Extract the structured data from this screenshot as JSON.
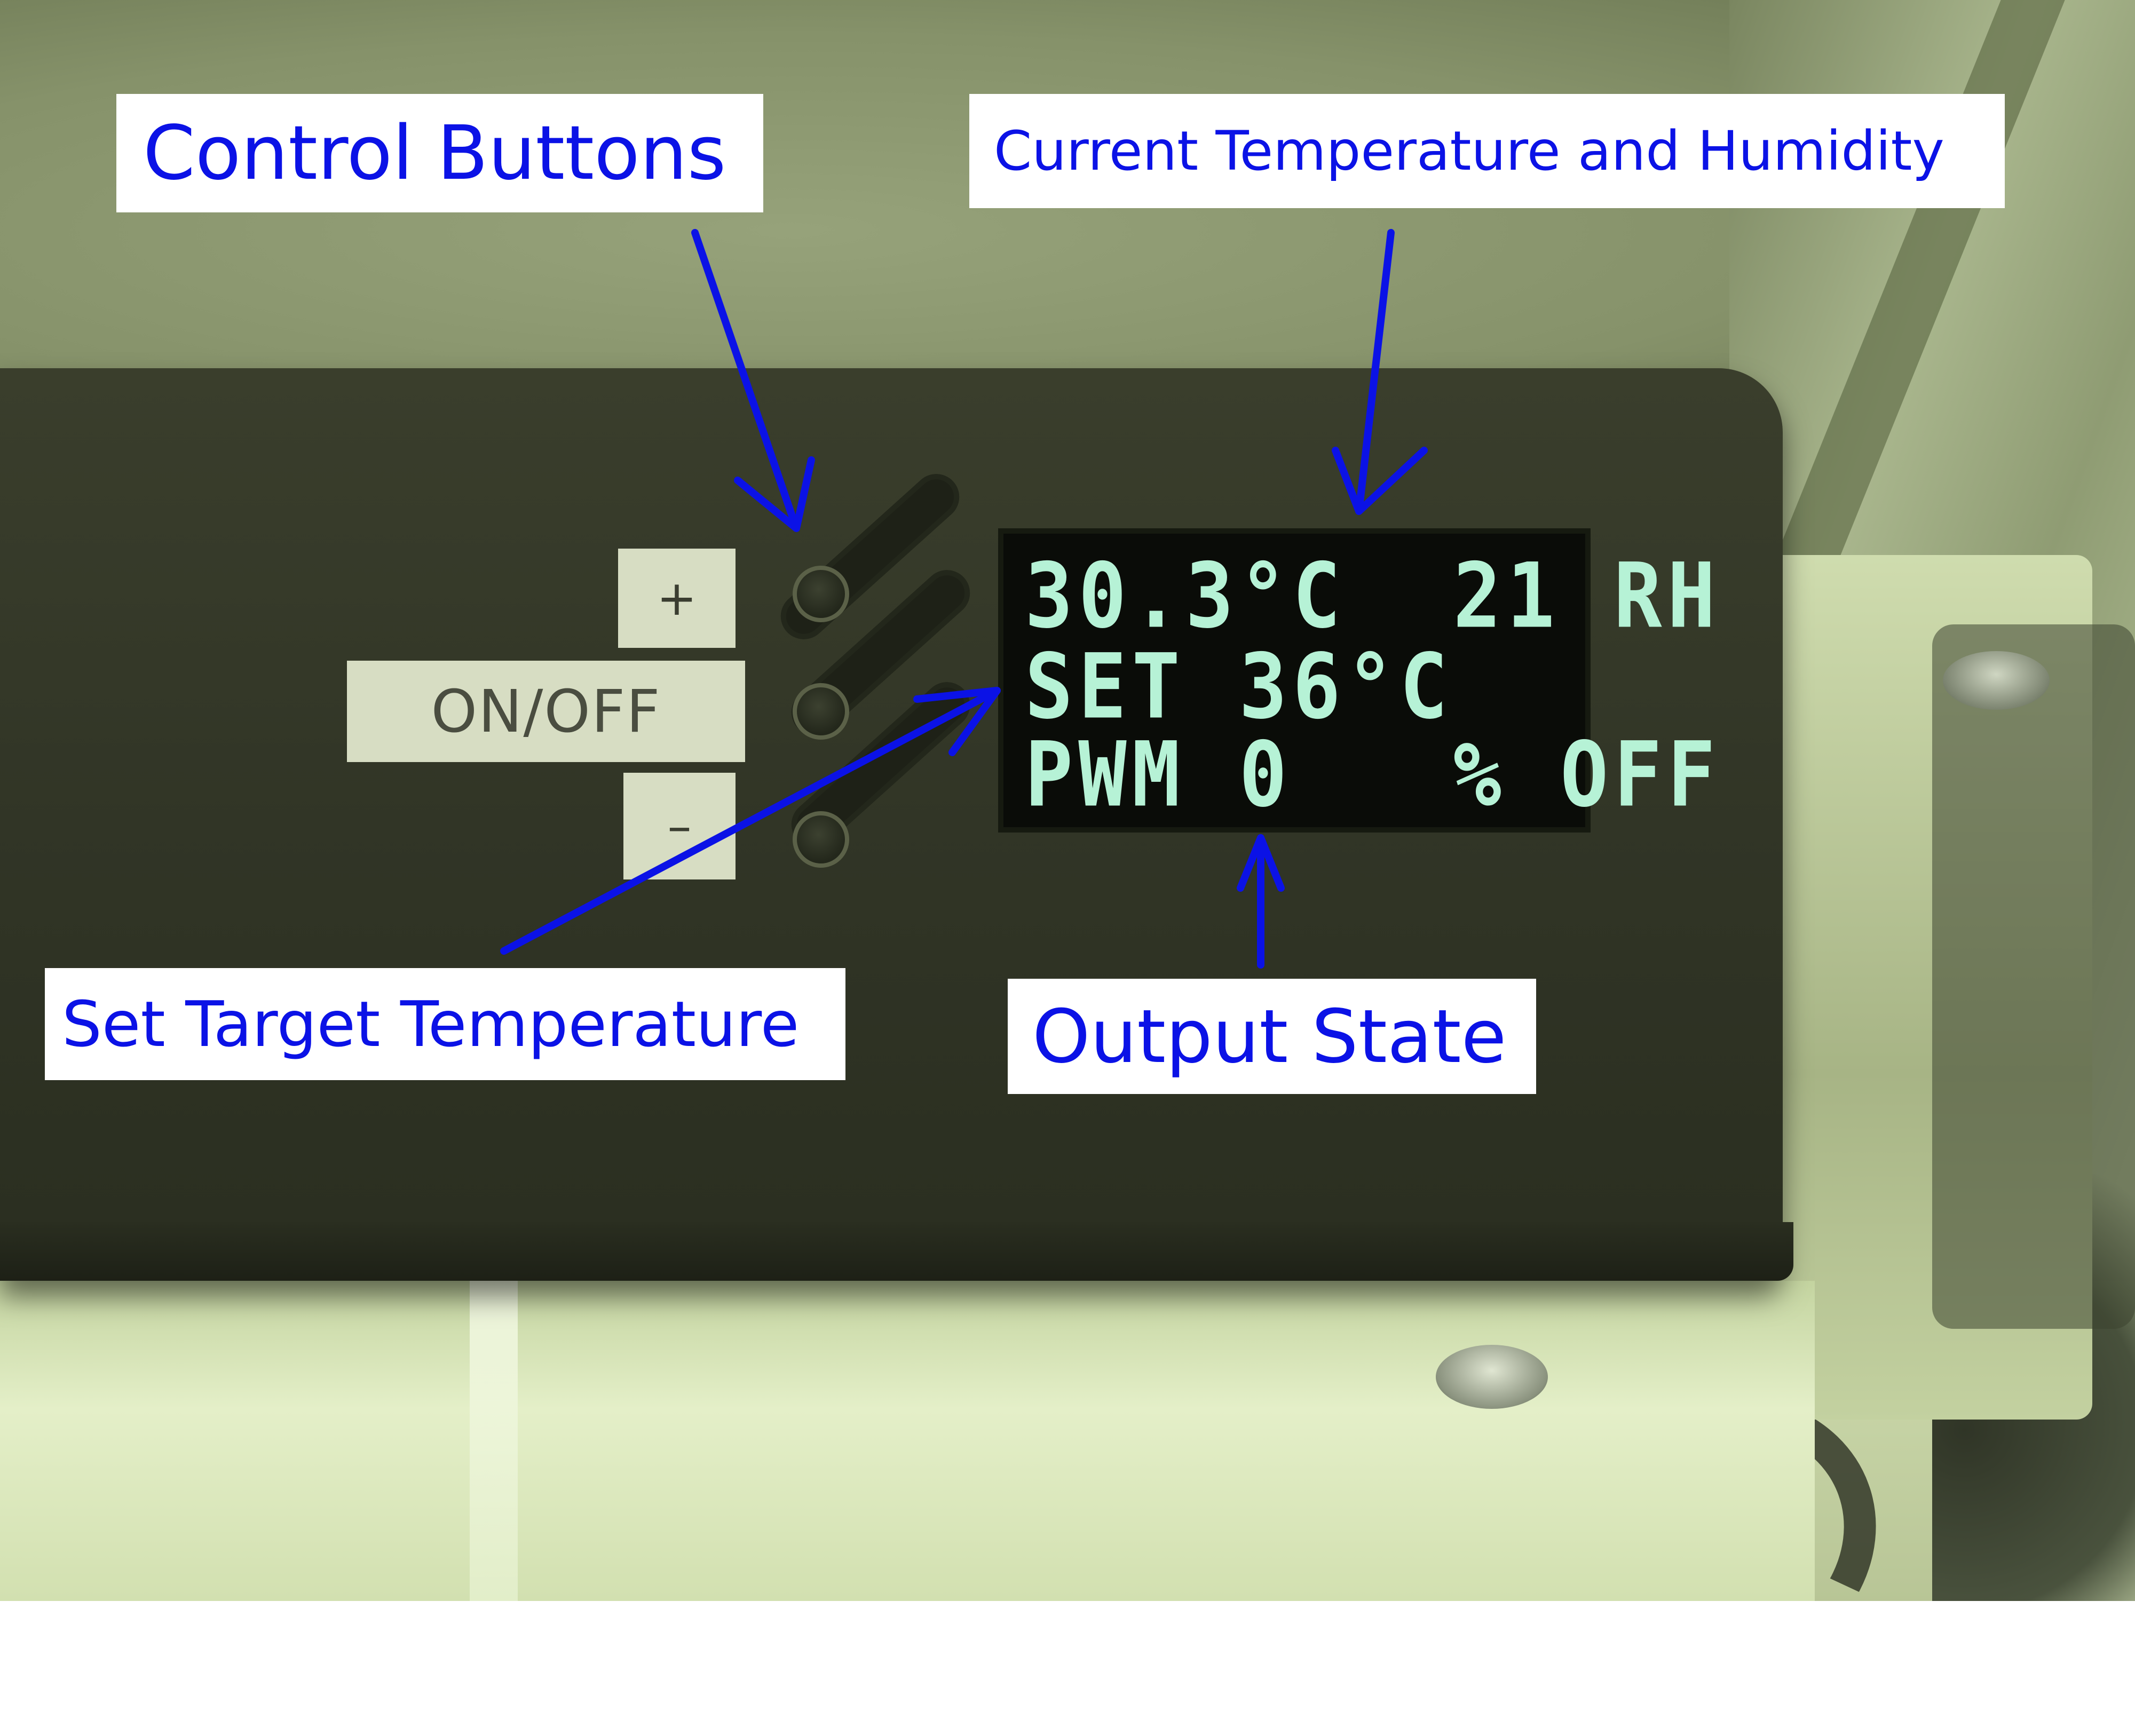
{
  "annotations": {
    "control_buttons": "Control Buttons",
    "current_temp_humidity": "Current Temperature and Humidity",
    "set_target_temperature": "Set Target Temperature",
    "output_state": "Output State"
  },
  "buttons": {
    "plus_label": "+",
    "onoff_label": "ON/OFF",
    "minus_label": "–"
  },
  "display": {
    "line1": "30.3°C  21 RH",
    "line2": "SET 36°C",
    "line3": "PWM 0   % OFF",
    "text_color": "#b6f2d6"
  },
  "colors": {
    "annotation_text": "#0b12e6",
    "arrow": "#0b12e6",
    "enclosure": "#33372a"
  }
}
